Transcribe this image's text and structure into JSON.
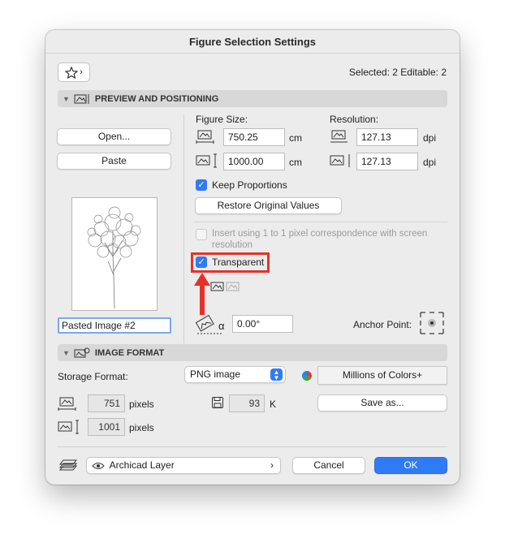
{
  "window": {
    "title": "Figure Selection Settings"
  },
  "header": {
    "selection_info": "Selected: 2 Editable: 2"
  },
  "sections": {
    "preview": "PREVIEW AND POSITIONING",
    "image_format": "IMAGE FORMAT"
  },
  "preview": {
    "open_label": "Open...",
    "paste_label": "Paste",
    "figure_size_label": "Figure Size:",
    "resolution_label": "Resolution:",
    "width_value": "750.25",
    "height_value": "1000.00",
    "size_unit": "cm",
    "res_x_value": "127.13",
    "res_y_value": "127.13",
    "res_unit": "dpi",
    "keep_proportions_label": "Keep Proportions",
    "keep_proportions_checked": true,
    "restore_label": "Restore Original Values",
    "insert_pixel_label": "Insert using 1 to 1 pixel correspondence with screen resolution",
    "insert_pixel_checked": false,
    "transparent_label": "Transparent",
    "transparent_checked": true,
    "image_name": "Pasted Image #2",
    "angle_value": "0.00°",
    "angle_symbol": "α",
    "anchor_label": "Anchor Point:"
  },
  "image_format": {
    "storage_label": "Storage Format:",
    "format_value": "PNG image",
    "colors_label": "Millions of Colors+",
    "width_pixels": "751",
    "height_pixels": "1001",
    "pixels_unit": "pixels",
    "size_value": "93",
    "size_unit": "K",
    "save_as_label": "Save as..."
  },
  "footer": {
    "layer_label": "Archicad Layer",
    "cancel_label": "Cancel",
    "ok_label": "OK"
  },
  "colors": {
    "accent": "#2f7bf6",
    "highlight": "#e4322b"
  },
  "icons": [
    "star-icon",
    "chevron-right-icon",
    "disclosure-triangle-icon",
    "figure-width-icon",
    "figure-height-icon",
    "transparent-toggle-icon",
    "rotation-angle-icon",
    "anchor-point-icon",
    "color-wheel-icon",
    "disk-icon",
    "layer-icon",
    "eye-icon"
  ]
}
